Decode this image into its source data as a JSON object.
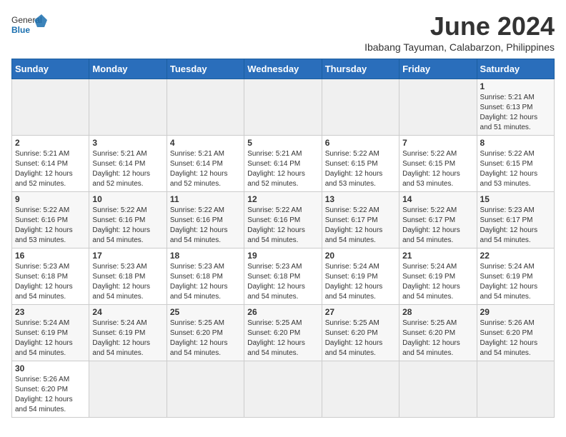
{
  "header": {
    "logo_general": "General",
    "logo_blue": "Blue",
    "month_title": "June 2024",
    "subtitle": "Ibabang Tayuman, Calabarzon, Philippines"
  },
  "weekdays": [
    "Sunday",
    "Monday",
    "Tuesday",
    "Wednesday",
    "Thursday",
    "Friday",
    "Saturday"
  ],
  "weeks": [
    [
      {
        "day": "",
        "info": ""
      },
      {
        "day": "",
        "info": ""
      },
      {
        "day": "",
        "info": ""
      },
      {
        "day": "",
        "info": ""
      },
      {
        "day": "",
        "info": ""
      },
      {
        "day": "",
        "info": ""
      },
      {
        "day": "1",
        "info": "Sunrise: 5:21 AM\nSunset: 6:13 PM\nDaylight: 12 hours\nand 51 minutes."
      }
    ],
    [
      {
        "day": "2",
        "info": "Sunrise: 5:21 AM\nSunset: 6:14 PM\nDaylight: 12 hours\nand 52 minutes."
      },
      {
        "day": "3",
        "info": "Sunrise: 5:21 AM\nSunset: 6:14 PM\nDaylight: 12 hours\nand 52 minutes."
      },
      {
        "day": "4",
        "info": "Sunrise: 5:21 AM\nSunset: 6:14 PM\nDaylight: 12 hours\nand 52 minutes."
      },
      {
        "day": "5",
        "info": "Sunrise: 5:21 AM\nSunset: 6:14 PM\nDaylight: 12 hours\nand 52 minutes."
      },
      {
        "day": "6",
        "info": "Sunrise: 5:22 AM\nSunset: 6:15 PM\nDaylight: 12 hours\nand 53 minutes."
      },
      {
        "day": "7",
        "info": "Sunrise: 5:22 AM\nSunset: 6:15 PM\nDaylight: 12 hours\nand 53 minutes."
      },
      {
        "day": "8",
        "info": "Sunrise: 5:22 AM\nSunset: 6:15 PM\nDaylight: 12 hours\nand 53 minutes."
      }
    ],
    [
      {
        "day": "9",
        "info": "Sunrise: 5:22 AM\nSunset: 6:16 PM\nDaylight: 12 hours\nand 53 minutes."
      },
      {
        "day": "10",
        "info": "Sunrise: 5:22 AM\nSunset: 6:16 PM\nDaylight: 12 hours\nand 54 minutes."
      },
      {
        "day": "11",
        "info": "Sunrise: 5:22 AM\nSunset: 6:16 PM\nDaylight: 12 hours\nand 54 minutes."
      },
      {
        "day": "12",
        "info": "Sunrise: 5:22 AM\nSunset: 6:16 PM\nDaylight: 12 hours\nand 54 minutes."
      },
      {
        "day": "13",
        "info": "Sunrise: 5:22 AM\nSunset: 6:17 PM\nDaylight: 12 hours\nand 54 minutes."
      },
      {
        "day": "14",
        "info": "Sunrise: 5:22 AM\nSunset: 6:17 PM\nDaylight: 12 hours\nand 54 minutes."
      },
      {
        "day": "15",
        "info": "Sunrise: 5:23 AM\nSunset: 6:17 PM\nDaylight: 12 hours\nand 54 minutes."
      }
    ],
    [
      {
        "day": "16",
        "info": "Sunrise: 5:23 AM\nSunset: 6:18 PM\nDaylight: 12 hours\nand 54 minutes."
      },
      {
        "day": "17",
        "info": "Sunrise: 5:23 AM\nSunset: 6:18 PM\nDaylight: 12 hours\nand 54 minutes."
      },
      {
        "day": "18",
        "info": "Sunrise: 5:23 AM\nSunset: 6:18 PM\nDaylight: 12 hours\nand 54 minutes."
      },
      {
        "day": "19",
        "info": "Sunrise: 5:23 AM\nSunset: 6:18 PM\nDaylight: 12 hours\nand 54 minutes."
      },
      {
        "day": "20",
        "info": "Sunrise: 5:24 AM\nSunset: 6:19 PM\nDaylight: 12 hours\nand 54 minutes."
      },
      {
        "day": "21",
        "info": "Sunrise: 5:24 AM\nSunset: 6:19 PM\nDaylight: 12 hours\nand 54 minutes."
      },
      {
        "day": "22",
        "info": "Sunrise: 5:24 AM\nSunset: 6:19 PM\nDaylight: 12 hours\nand 54 minutes."
      }
    ],
    [
      {
        "day": "23",
        "info": "Sunrise: 5:24 AM\nSunset: 6:19 PM\nDaylight: 12 hours\nand 54 minutes."
      },
      {
        "day": "24",
        "info": "Sunrise: 5:24 AM\nSunset: 6:19 PM\nDaylight: 12 hours\nand 54 minutes."
      },
      {
        "day": "25",
        "info": "Sunrise: 5:25 AM\nSunset: 6:20 PM\nDaylight: 12 hours\nand 54 minutes."
      },
      {
        "day": "26",
        "info": "Sunrise: 5:25 AM\nSunset: 6:20 PM\nDaylight: 12 hours\nand 54 minutes."
      },
      {
        "day": "27",
        "info": "Sunrise: 5:25 AM\nSunset: 6:20 PM\nDaylight: 12 hours\nand 54 minutes."
      },
      {
        "day": "28",
        "info": "Sunrise: 5:25 AM\nSunset: 6:20 PM\nDaylight: 12 hours\nand 54 minutes."
      },
      {
        "day": "29",
        "info": "Sunrise: 5:26 AM\nSunset: 6:20 PM\nDaylight: 12 hours\nand 54 minutes."
      }
    ],
    [
      {
        "day": "30",
        "info": "Sunrise: 5:26 AM\nSunset: 6:20 PM\nDaylight: 12 hours\nand 54 minutes."
      },
      {
        "day": "",
        "info": ""
      },
      {
        "day": "",
        "info": ""
      },
      {
        "day": "",
        "info": ""
      },
      {
        "day": "",
        "info": ""
      },
      {
        "day": "",
        "info": ""
      },
      {
        "day": "",
        "info": ""
      }
    ]
  ]
}
